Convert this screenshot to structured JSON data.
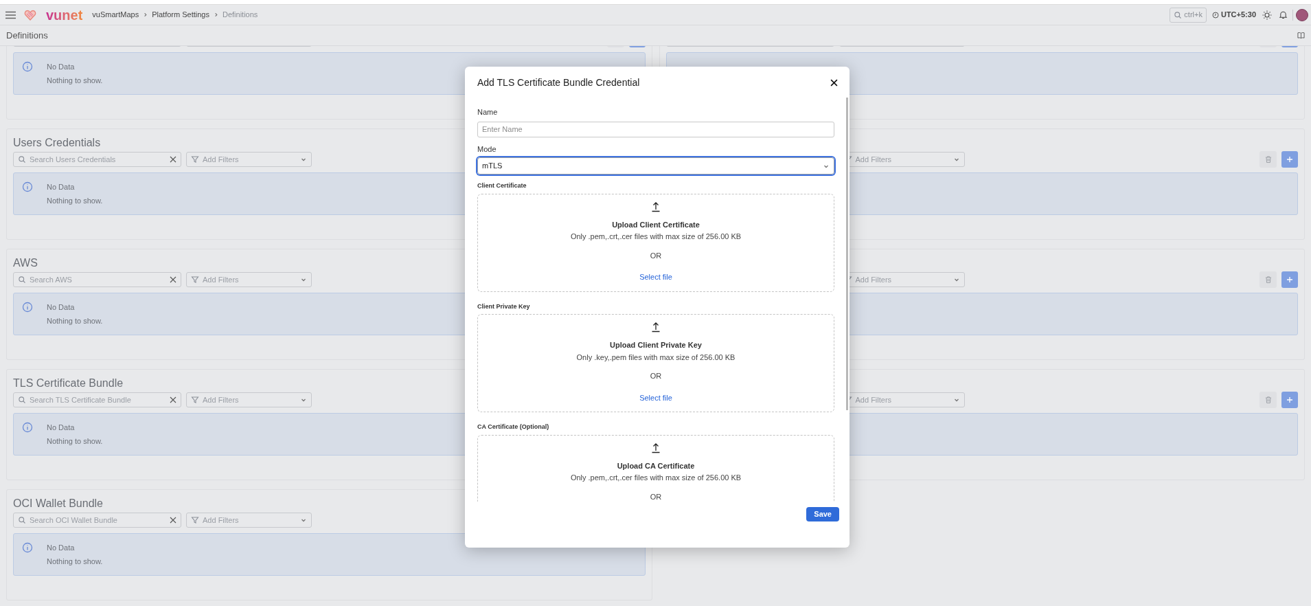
{
  "header": {
    "logo_text": "vunet",
    "breadcrumbs": [
      {
        "label": "vuSmartMaps",
        "current": false
      },
      {
        "label": "Platform Settings",
        "current": false
      },
      {
        "label": "Definitions",
        "current": true
      }
    ],
    "search_shortcut": "ctrl+k",
    "timezone": "UTC+5:30"
  },
  "page_title": "Definitions",
  "left_sections": [
    {
      "kind": "clipped",
      "no_data": {
        "title": "No Data",
        "text": "Nothing to show."
      }
    },
    {
      "title": "Users Credentials",
      "search_placeholder": "Search Users Credentials",
      "filter_placeholder": "Add Filters",
      "no_data": {
        "title": "No Data",
        "text": "Nothing to show."
      }
    },
    {
      "title": "AWS",
      "search_placeholder": "Search AWS",
      "filter_placeholder": "Add Filters",
      "no_data": {
        "title": "No Data",
        "text": "Nothing to show."
      }
    },
    {
      "title": "TLS Certificate Bundle",
      "search_placeholder": "Search TLS Certificate Bundle",
      "filter_placeholder": "Add Filters",
      "no_data": {
        "title": "No Data",
        "text": "Nothing to show."
      }
    },
    {
      "title": "OCI Wallet Bundle",
      "search_placeholder": "Search OCI Wallet Bundle",
      "filter_placeholder": "Add Filters",
      "no_data": {
        "title": "No Data",
        "text": "Nothing to show."
      }
    }
  ],
  "right_sections": [
    {
      "kind": "clipped"
    },
    {
      "filter_placeholder": "Add Filters"
    },
    {
      "filter_placeholder": "Add Filters"
    },
    {
      "filter_placeholder": "Add Filters"
    }
  ],
  "dialog": {
    "title": "Add TLS Certificate Bundle Credential",
    "name_field": {
      "label": "Name",
      "placeholder": "Enter Name"
    },
    "mode_field": {
      "label": "Mode",
      "value": "mTLS",
      "focused": true
    },
    "uploads": [
      {
        "label": "Client Certificate",
        "title": "Upload Client Certificate",
        "hint": "Only .pem,.crt,.cer files with max size of 256.00 KB",
        "or_text": "OR",
        "link": "Select file"
      },
      {
        "label": "Client Private Key",
        "title": "Upload Client Private Key",
        "hint": "Only .key,.pem files with max size of 256.00 KB",
        "or_text": "OR",
        "link": "Select file"
      },
      {
        "label": "CA Certificate (Optional)",
        "title": "Upload CA Certificate",
        "hint": "Only .pem,.crt,.cer files with max size of 256.00 KB",
        "or_text": "OR"
      }
    ],
    "save_button": "Save"
  }
}
